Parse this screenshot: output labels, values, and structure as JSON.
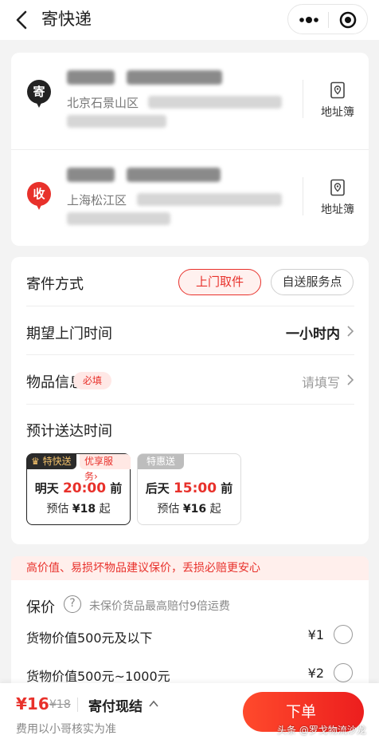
{
  "header": {
    "title": "寄快递",
    "more_icon": "more-dots-icon",
    "close_icon": "target-close-icon"
  },
  "sender": {
    "badge": "寄",
    "badge_color": "#222222",
    "address_prefix": "北京石景山区",
    "address_book": "地址簿"
  },
  "receiver": {
    "badge": "收",
    "badge_color": "#e8312b",
    "address_prefix": "上海松江区",
    "address_book": "地址簿"
  },
  "shipping_method": {
    "label": "寄件方式",
    "options": [
      {
        "label": "上门取件",
        "selected": true
      },
      {
        "label": "自送服务点",
        "selected": false
      }
    ]
  },
  "pickup_time": {
    "label": "期望上门时间",
    "value": "一小时内"
  },
  "item_info": {
    "label": "物品信息",
    "required_badge": "必填",
    "placeholder": "请填写"
  },
  "delivery_estimate": {
    "label": "预计送达时间",
    "options": [
      {
        "tag": "特快送",
        "extra_tag": "优享服务",
        "day": "明天",
        "time": "20:00",
        "suffix": "前",
        "est_prefix": "预估",
        "price": "¥18",
        "est_suffix": "起",
        "selected": true
      },
      {
        "tag": "特惠送",
        "day": "后天",
        "time": "15:00",
        "suffix": "前",
        "est_prefix": "预估",
        "price": "¥16",
        "est_suffix": "起",
        "selected": false
      }
    ]
  },
  "insurance": {
    "notice": "高价值、易损坏物品建议保价，丢损必赔更安心",
    "title": "保价",
    "help_icon": "question-circle-icon",
    "subtitle": "未保价货品最高赔付9倍运费",
    "options": [
      {
        "label": "货物价值500元及以下",
        "price": "¥1"
      },
      {
        "label": "货物价值500元~1000元",
        "price": "¥2"
      }
    ]
  },
  "footer": {
    "price": "¥16",
    "original_price": "¥18",
    "pay_mode": "寄付现结",
    "note": "费用以小哥核实为准",
    "submit": "下单",
    "watermark": "头条 @罗戈物流沙龙"
  },
  "colors": {
    "accent": "#e8312b",
    "dark": "#222222"
  }
}
